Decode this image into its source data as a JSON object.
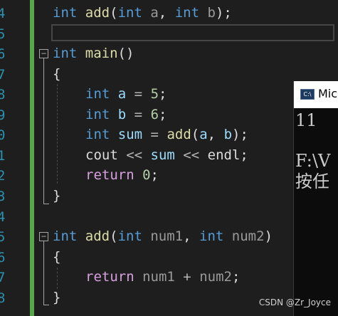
{
  "editor": {
    "line_numbers": [
      "4",
      "5",
      "6",
      "7",
      "8",
      "9",
      "0",
      "1",
      "2",
      "3",
      "4",
      "5",
      "6",
      "7",
      "8"
    ],
    "lines": {
      "l4": {
        "t1": "int",
        "t2": " ",
        "t3": "add",
        "t4": "(",
        "t5": "int",
        "t6": " ",
        "t7": "a",
        ",": ",",
        "t8": " ",
        "t9": "int",
        "t10": " ",
        "t11": "b",
        "t12": ");"
      },
      "l6": {
        "t1": "int",
        "t2": " ",
        "t3": "main",
        "t4": "()"
      },
      "l7": {
        "t1": "{"
      },
      "l8": {
        "t1": "int",
        "t2": " ",
        "t3": "a",
        "t4": " = ",
        "t5": "5",
        "t6": ";"
      },
      "l9": {
        "t1": "int",
        "t2": " ",
        "t3": "b",
        "t4": " = ",
        "t5": "6",
        "t6": ";"
      },
      "l10": {
        "t1": "int",
        "t2": " ",
        "t3": "sum",
        "t4": " = ",
        "t5": "add",
        "t6": "(",
        "t7": "a",
        "t8": ", ",
        "t9": "b",
        "t10": ");"
      },
      "l11": {
        "t1": "cout",
        "t2": " << ",
        "t3": "sum",
        "t4": " << ",
        "t5": "endl",
        "t6": ";"
      },
      "l12": {
        "t1": "return",
        "t2": " ",
        "t3": "0",
        "t4": ";"
      },
      "l13": {
        "t1": "}"
      },
      "l15": {
        "t1": "int",
        "t2": " ",
        "t3": "add",
        "t4": "(",
        "t5": "int",
        "t6": " ",
        "t7": "num1",
        ",": ",",
        "t8": " ",
        "t9": "int",
        "t10": " ",
        "t11": "num2",
        "t12": ")"
      },
      "l16": {
        "t1": "{"
      },
      "l17": {
        "t1": "return",
        "t2": " ",
        "t3": "num1",
        "t4": " + ",
        "t5": "num2",
        "t6": ";"
      },
      "l18": {
        "t1": "}"
      }
    },
    "fold_symbol": "−"
  },
  "console": {
    "title": "Mic",
    "icon_label": "C:\\",
    "output_lines": [
      "11",
      "",
      "F:\\V",
      "按任"
    ]
  },
  "watermark": "CSDN @Zr_Joyce",
  "colors": {
    "background": "#1e1e1e",
    "keyword": "#569cd6",
    "function": "#dcdcaa",
    "variable": "#9cdcfe",
    "control": "#d8a0df",
    "number": "#b5cea8",
    "line_number": "#2b91af",
    "change_bar": "#57a64a"
  }
}
